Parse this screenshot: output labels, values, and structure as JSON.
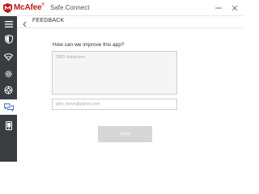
{
  "app": {
    "brand": "McAfee",
    "brand_mark": "®",
    "name": "Safe Connect"
  },
  "header": {
    "title": "FEEDBACK"
  },
  "sidebar": {
    "items": [
      {
        "icon": "menu-icon"
      },
      {
        "icon": "shield-icon"
      },
      {
        "icon": "wifi-icon"
      },
      {
        "icon": "gear-icon"
      },
      {
        "icon": "support-icon"
      },
      {
        "icon": "feedback-icon",
        "active": true
      },
      {
        "icon": "device-icon"
      }
    ]
  },
  "form": {
    "question": "How can we improve this app?",
    "feedback_placeholder": "2000 characters",
    "email_placeholder": "john_fomm@yahoo.com",
    "send_label": "Send"
  },
  "colors": {
    "brand_red": "#c01818",
    "sidebar_bg": "#3a3d40",
    "button_disabled": "#d6d6d6"
  }
}
